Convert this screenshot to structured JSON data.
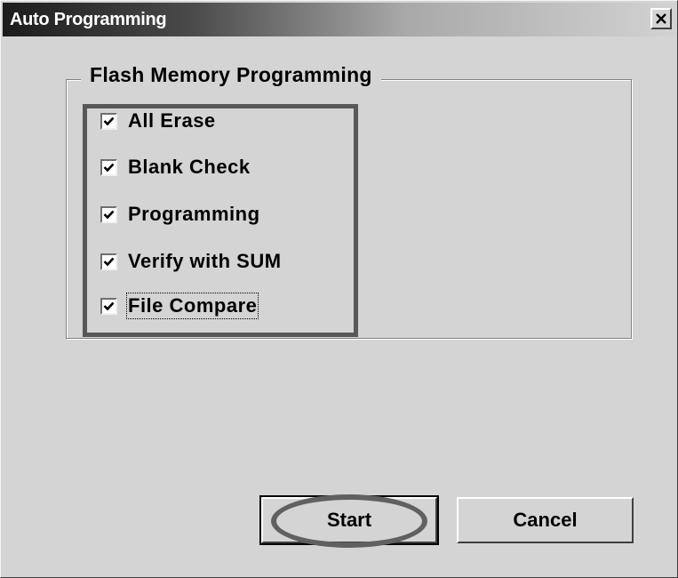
{
  "window": {
    "title": "Auto Programming",
    "close_icon": "close-icon"
  },
  "group": {
    "legend": "Flash Memory Programming",
    "items": [
      {
        "label": "All Erase",
        "checked": true
      },
      {
        "label": "Blank Check",
        "checked": true
      },
      {
        "label": "Programming",
        "checked": true
      },
      {
        "label": "Verify with SUM",
        "checked": true
      },
      {
        "label": "File Compare",
        "checked": true,
        "focused": true
      }
    ]
  },
  "buttons": {
    "start_label": "Start",
    "cancel_label": "Cancel"
  },
  "colors": {
    "face": "#d4d4d4",
    "annotation": "#585858"
  }
}
